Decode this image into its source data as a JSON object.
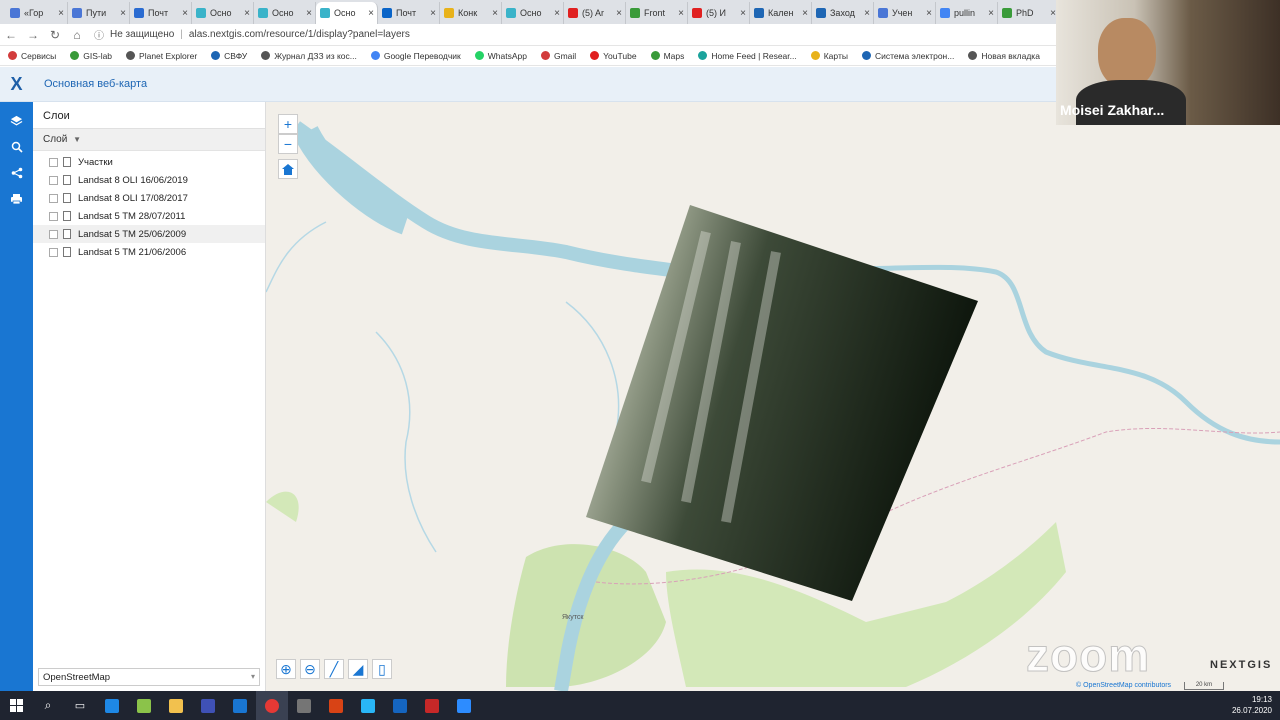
{
  "browser": {
    "tabs": [
      {
        "label": "«Гор",
        "color": "#4a76d6"
      },
      {
        "label": "Пути",
        "color": "#4a76d6"
      },
      {
        "label": "Почт",
        "color": "#2a6bd1"
      },
      {
        "label": "Осно",
        "color": "#3ab3c9"
      },
      {
        "label": "Осно",
        "color": "#3ab3c9"
      },
      {
        "label": "Осно",
        "color": "#3ab3c9"
      },
      {
        "label": "Почт",
        "color": "#0a64c8"
      },
      {
        "label": "Конк",
        "color": "#e8b21a"
      },
      {
        "label": "Осно",
        "color": "#3ab3c9"
      },
      {
        "label": "(5) Ar",
        "color": "#e02020"
      },
      {
        "label": "Front",
        "color": "#3a9b3a"
      },
      {
        "label": "(5) И",
        "color": "#e02020"
      },
      {
        "label": "Кален",
        "color": "#1e66b4"
      },
      {
        "label": "Заход",
        "color": "#1e66b4"
      },
      {
        "label": "Учен",
        "color": "#4a76d6"
      },
      {
        "label": "pullin",
        "color": "#4285f4"
      },
      {
        "label": "PhD",
        "color": "#3a9b3a"
      }
    ],
    "active_tab_index": 5,
    "security_label": "Не защищено",
    "url": "alas.nextgis.com/resource/1/display?panel=layers",
    "bookmarks": [
      {
        "label": "Сервисы",
        "color": "#d23c3c"
      },
      {
        "label": "GIS-lab",
        "color": "#3a9b3a"
      },
      {
        "label": "Planet Explorer",
        "color": "#555555"
      },
      {
        "label": "СВФУ",
        "color": "#1e66b4"
      },
      {
        "label": "Журнал ДЗЗ из кос...",
        "color": "#555555"
      },
      {
        "label": "Google Переводчик",
        "color": "#4285f4"
      },
      {
        "label": "WhatsApp",
        "color": "#25d366"
      },
      {
        "label": "Gmail",
        "color": "#d23c3c"
      },
      {
        "label": "YouTube",
        "color": "#e02020"
      },
      {
        "label": "Maps",
        "color": "#3a9b3a"
      },
      {
        "label": "Home Feed | Resear...",
        "color": "#1ba39c"
      },
      {
        "label": "Карты",
        "color": "#e8b21a"
      },
      {
        "label": "Система электрон...",
        "color": "#1e66b4"
      },
      {
        "label": "Новая вкладка",
        "color": "#555555"
      }
    ]
  },
  "app": {
    "title": "Основная веб-карта",
    "panel_title": "Слои",
    "layer_menu_label": "Слой",
    "layers": [
      {
        "label": "Участки",
        "highlighted": false
      },
      {
        "label": "Landsat 8 OLI 16/06/2019",
        "highlighted": false
      },
      {
        "label": "Landsat 8 OLI 17/08/2017",
        "highlighted": false
      },
      {
        "label": "Landsat 5 TM 28/07/2011",
        "highlighted": false
      },
      {
        "label": "Landsat 5 TM 25/06/2009",
        "highlighted": true
      },
      {
        "label": "Landsat 5 TM 21/06/2006",
        "highlighted": false
      }
    ],
    "basemap_select": "OpenStreetMap",
    "map": {
      "city_label": "Якутск",
      "attribution": "© OpenStreetMap contributors",
      "scale_label": "20 km"
    }
  },
  "overlay": {
    "participant_name": "Moisei Zakhar...",
    "zoom_watermark": "zoom",
    "brand_watermark": "NEXTGIS"
  },
  "taskbar": {
    "time": "19:13",
    "date": "26.07.2020"
  }
}
